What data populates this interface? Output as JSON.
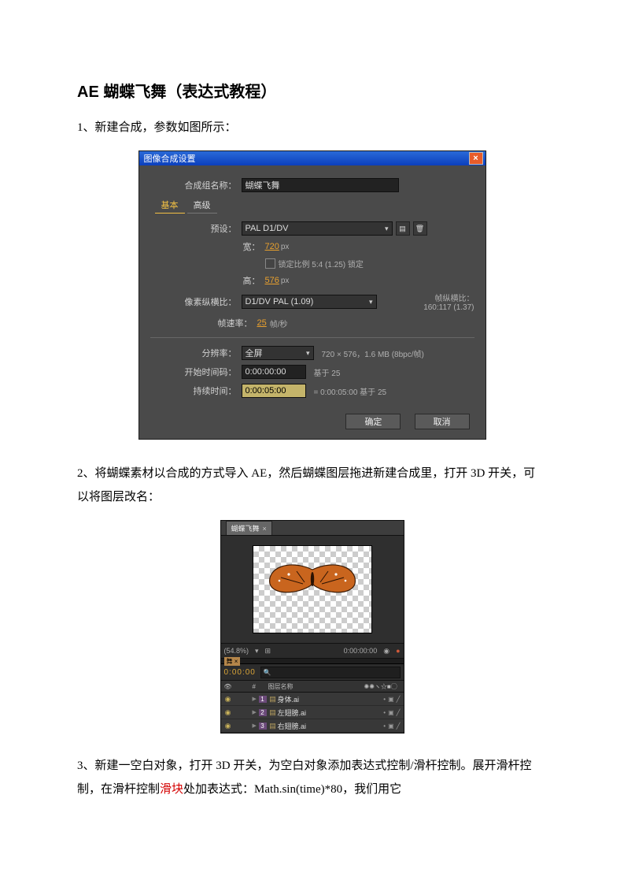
{
  "title": "AE 蝴蝶飞舞（表达式教程）",
  "p1": "1、新建合成，参数如图所示：",
  "p2": "2、将蝴蝶素材以合成的方式导入 AE，然后蝴蝶图层拖进新建合成里，打开 3D 开关，可以将图层改名：",
  "p3_a": "3、新建一空白对象，打开 3D 开关，为空白对象添加表达式控制/滑杆控制。展开滑杆控制，在滑杆控制",
  "p3_red": "滑块",
  "p3_b": "处加表达式：Math.sin(time)*80，我们用它",
  "dlg": {
    "title": "图像合成设置",
    "name_lbl": "合成组名称：",
    "name_val": "蝴蝶飞舞",
    "tab_basic": "基本",
    "tab_adv": "高级",
    "preset_lbl": "预设：",
    "preset_val": "PAL D1/DV",
    "width_lbl": "宽：",
    "width_val": "720",
    "px": "px",
    "height_lbl": "高：",
    "height_val": "576",
    "lock_aspect": "锁定比例 5:4 (1.25) 锁定",
    "par_lbl": "像素纵横比：",
    "par_val": "D1/DV PAL (1.09)",
    "par_note1": "帧纵横比：",
    "par_note2": "160:117 (1.37)",
    "fps_lbl": "帧速率：",
    "fps_val": "25",
    "fps_unit": "帧/秒",
    "res_lbl": "分辨率：",
    "res_val": "全屏",
    "res_note": "720 × 576，1.6 MB (8bpc/帧)",
    "start_lbl": "开始时间码：",
    "start_val": "0:00:00:00",
    "start_note": "基于 25",
    "dur_lbl": "持续时间：",
    "dur_val": "0:00:05:00",
    "dur_note": "= 0:00:05:00  基于 25",
    "ok": "确定",
    "cancel": "取消"
  },
  "panel": {
    "tab": "蝴蝶飞舞",
    "zoom": "(54.8%)",
    "tc_big": "0:00:00:00",
    "timecode": "0:00:00",
    "col_name": "图层名称",
    "layers": [
      {
        "n": "1",
        "name": "身体.ai"
      },
      {
        "n": "2",
        "name": "左翅膀.ai"
      },
      {
        "n": "3",
        "name": "右翅膀.ai"
      }
    ]
  }
}
